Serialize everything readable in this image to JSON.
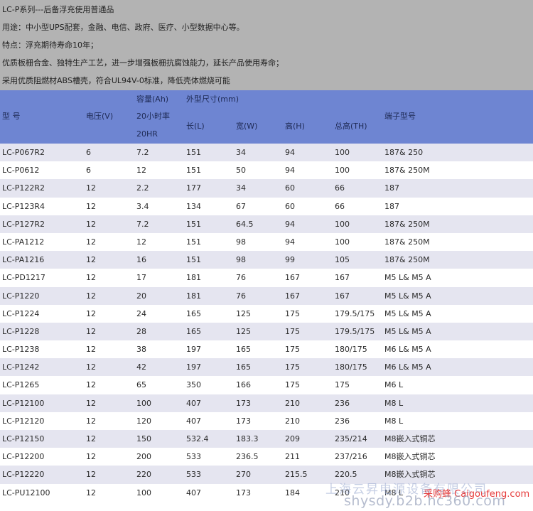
{
  "intro": {
    "title": "LC-P系列---后备浮充使用普通品",
    "usage": "用途：中小型UPS配套，金融、电信、政府、医疗、小型数据中心等。",
    "feature": "特点：浮充期待寿命10年；",
    "detail1": "优质板栅合金、独特生产工艺，进一步增强板栅抗腐蚀能力，延长产品使用寿命；",
    "detail2": "采用优质阻燃材ABS槽壳，符合UL94V-0标准，降低壳体燃烧可能"
  },
  "header": {
    "model": "型  号",
    "voltage": "电压(V)",
    "capacity_1": "容量(Ah)",
    "capacity_2": "20小时率",
    "capacity_3": "20HR",
    "dimensions": "外型尺寸(mm)",
    "length": "长(L)",
    "width": "宽(W)",
    "height": "高(H)",
    "total_height": "总高(TH)",
    "terminal": "端子型号"
  },
  "rows": [
    [
      "LC-P067R2",
      "6",
      "7.2",
      "151",
      "34",
      "94",
      "100",
      "187& 250"
    ],
    [
      "LC-P0612",
      "6",
      "12",
      "151",
      "50",
      "94",
      "100",
      "187& 250M"
    ],
    [
      "LC-P122R2",
      "12",
      "2.2",
      "177",
      "34",
      "60",
      "66",
      "187"
    ],
    [
      "LC-P123R4",
      "12",
      "3.4",
      "134",
      "67",
      "60",
      "66",
      "187"
    ],
    [
      "LC-P127R2",
      "12",
      "7.2",
      "151",
      "64.5",
      "94",
      "100",
      "187& 250M"
    ],
    [
      "LC-PA1212",
      "12",
      "12",
      "151",
      "98",
      "94",
      "100",
      "187& 250M"
    ],
    [
      "LC-PA1216",
      "12",
      "16",
      "151",
      "98",
      "99",
      "105",
      "187& 250M"
    ],
    [
      "LC-PD1217",
      "12",
      "17",
      "181",
      "76",
      "167",
      "167",
      "M5 L& M5 A"
    ],
    [
      "LC-P1220",
      "12",
      "20",
      "181",
      "76",
      "167",
      "167",
      "M5 L& M5 A"
    ],
    [
      "LC-P1224",
      "12",
      "24",
      "165",
      "125",
      "175",
      "179.5/175",
      "M5 L& M5 A"
    ],
    [
      "LC-P1228",
      "12",
      "28",
      "165",
      "125",
      "175",
      "179.5/175",
      "M5 L& M5 A"
    ],
    [
      "LC-P1238",
      "12",
      "38",
      "197",
      "165",
      "175",
      "180/175",
      "M6 L& M5 A"
    ],
    [
      "LC-P1242",
      "12",
      "42",
      "197",
      "165",
      "175",
      "180/175",
      "M6 L& M5 A"
    ],
    [
      "LC-P1265",
      "12",
      "65",
      "350",
      "166",
      "175",
      "175",
      "M6 L"
    ],
    [
      "LC-P12100",
      "12",
      "100",
      "407",
      "173",
      "210",
      "236",
      "M8 L"
    ],
    [
      "LC-P12120",
      "12",
      "120",
      "407",
      "173",
      "210",
      "236",
      "M8 L"
    ],
    [
      "LC-P12150",
      "12",
      "150",
      "532.4",
      "183.3",
      "209",
      "235/214",
      "M8嵌入式铜芯"
    ],
    [
      "LC-P12200",
      "12",
      "200",
      "533",
      "236.5",
      "211",
      "237/216",
      "M8嵌入式铜芯"
    ],
    [
      "LC-P12220",
      "12",
      "220",
      "533",
      "270",
      "215.5",
      "220.5",
      "M8嵌入式铜芯"
    ],
    [
      "LC-PU12100",
      "12",
      "100",
      "407",
      "173",
      "184",
      "210",
      "M8 L"
    ]
  ],
  "watermark": {
    "company": "上海云昇电源设备有限公司",
    "site": "采购蜂 Caigoufeng.com",
    "url": "shysdy.b2b.hc360.com"
  }
}
